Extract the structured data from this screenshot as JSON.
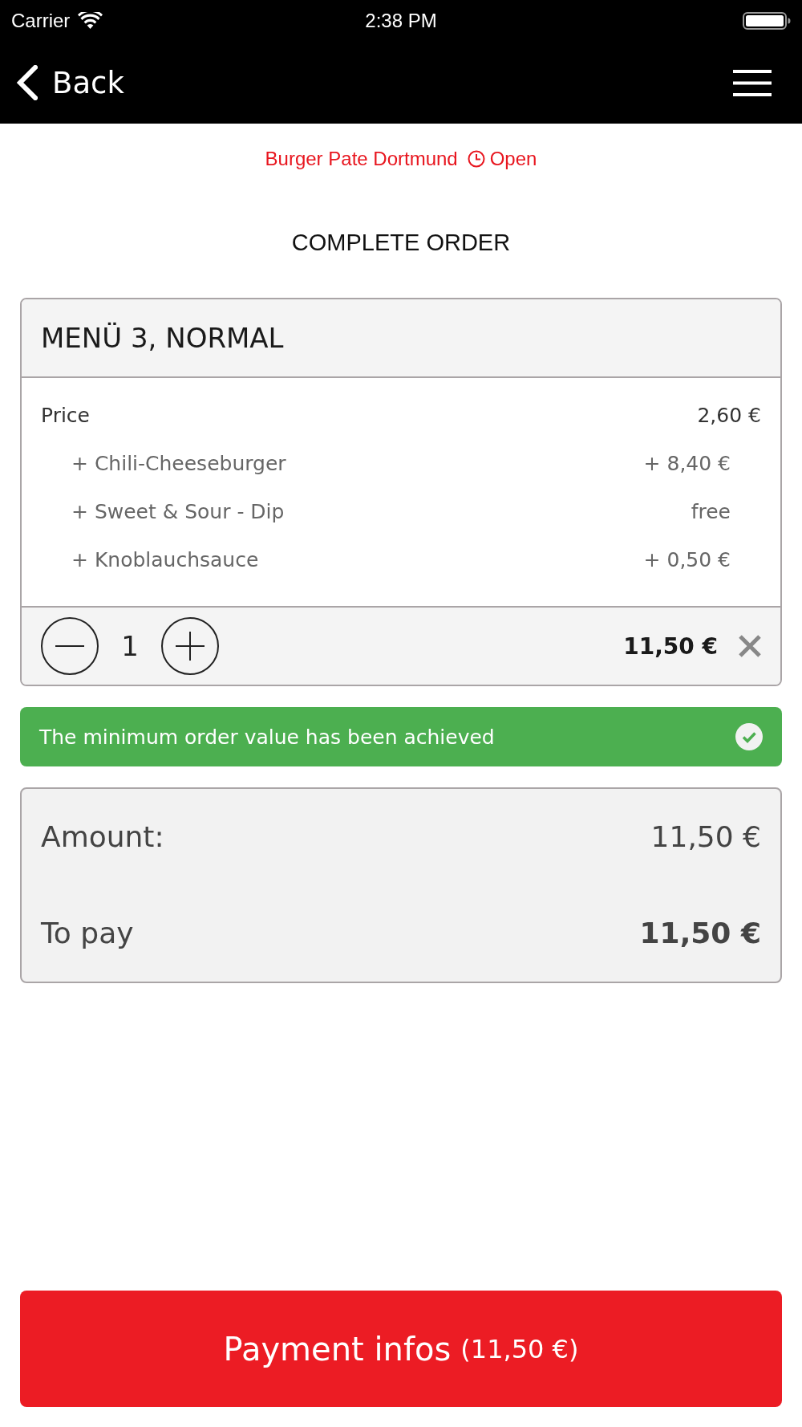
{
  "status_bar": {
    "carrier": "Carrier",
    "time": "2:38 PM"
  },
  "nav_bar": {
    "back_label": "Back"
  },
  "restaurant": {
    "name": "Burger Pate Dortmund",
    "status": "Open"
  },
  "page_title": "COMPLETE ORDER",
  "order_item": {
    "title": "MENÜ 3, NORMAL",
    "price_label": "Price",
    "price": "2,60 €",
    "options": [
      {
        "label": "+ Chili-Cheeseburger",
        "price": "+ 8,40 €"
      },
      {
        "label": "+ Sweet & Sour - Dip",
        "price": "free"
      },
      {
        "label": "+ Knoblauchsauce",
        "price": "+ 0,50 €"
      }
    ],
    "quantity": "1",
    "total": "11,50 €"
  },
  "notice": {
    "text": "The minimum order value has been achieved",
    "achieved": true
  },
  "summary": [
    {
      "kind": "subtotal",
      "label": "Amount:",
      "value": "11,50 €"
    },
    {
      "kind": "total",
      "label": "To pay",
      "value": "11,50 €"
    }
  ],
  "payment_button": {
    "label": "Payment infos",
    "amount": "(11,50 €)"
  }
}
